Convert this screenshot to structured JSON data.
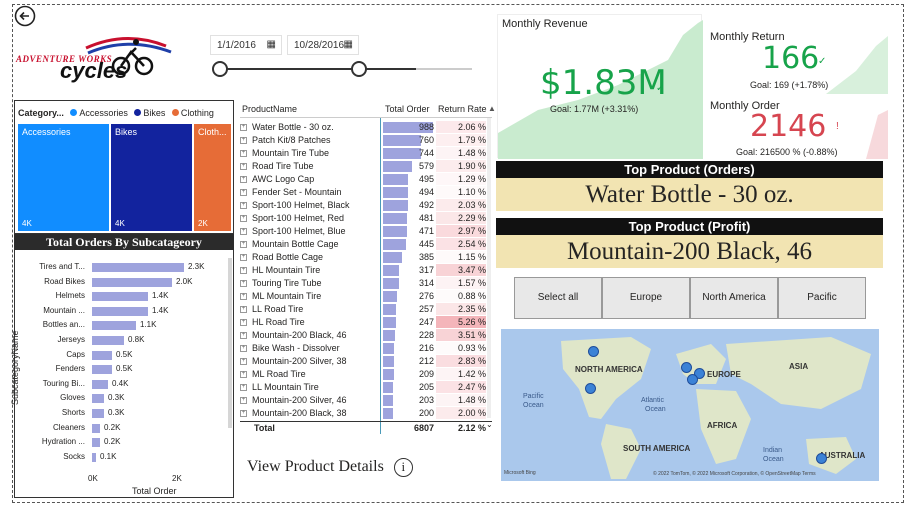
{
  "logo": {
    "line1": "ADVENTURE WORKS",
    "line2": "cycles"
  },
  "dates": {
    "start": "1/1/2016",
    "end": "10/28/2016"
  },
  "treemap": {
    "legend_title": "Category...",
    "tiles": [
      {
        "label": "Accessories",
        "value": "4K",
        "color": "#118dff"
      },
      {
        "label": "Bikes",
        "value": "4K",
        "color": "#12239e"
      },
      {
        "label": "Cloth...",
        "value": "2K",
        "color": "#e66c37"
      }
    ],
    "legend": [
      {
        "label": "Accessories",
        "color": "#118dff"
      },
      {
        "label": "Bikes",
        "color": "#12239e"
      },
      {
        "label": "Clothing",
        "color": "#e66c37"
      }
    ]
  },
  "subcategory_chart": {
    "title": "Total Orders By Subcatageory",
    "ylabel": "SubcategoryName",
    "xlabel": "Total Order",
    "ticks": [
      "0K",
      "2K"
    ]
  },
  "chart_data": {
    "type": "bar",
    "title": "Total Orders By Subcatageory",
    "xlabel": "Total Order",
    "ylabel": "SubcategoryName",
    "categories": [
      "Tires and T...",
      "Road Bikes",
      "Helmets",
      "Mountain ...",
      "Bottles an...",
      "Jerseys",
      "Caps",
      "Fenders",
      "Touring Bi...",
      "Gloves",
      "Shorts",
      "Cleaners",
      "Hydration ...",
      "Socks"
    ],
    "values": [
      2300,
      2000,
      1400,
      1400,
      1100,
      800,
      500,
      500,
      400,
      300,
      300,
      200,
      200,
      100
    ],
    "value_labels": [
      "2.3K",
      "2.0K",
      "1.4K",
      "1.4K",
      "1.1K",
      "0.8K",
      "0.5K",
      "0.5K",
      "0.4K",
      "0.3K",
      "0.3K",
      "0.2K",
      "0.2K",
      "0.1K"
    ],
    "xlim": [
      0,
      2500
    ]
  },
  "table": {
    "headers": {
      "name": "ProductName",
      "order": "Total Order",
      "ret": "Return Rate"
    },
    "rows": [
      {
        "name": "Water Bottle - 30 oz.",
        "order": 988,
        "order_s": "988",
        "ret": 2.06,
        "ret_s": "2.06 %"
      },
      {
        "name": "Patch Kit/8 Patches",
        "order": 760,
        "order_s": "760",
        "ret": 1.79,
        "ret_s": "1.79 %"
      },
      {
        "name": "Mountain Tire Tube",
        "order": 744,
        "order_s": "744",
        "ret": 1.48,
        "ret_s": "1.48 %"
      },
      {
        "name": "Road Tire Tube",
        "order": 579,
        "order_s": "579",
        "ret": 1.9,
        "ret_s": "1.90 %"
      },
      {
        "name": "AWC Logo Cap",
        "order": 495,
        "order_s": "495",
        "ret": 1.29,
        "ret_s": "1.29 %"
      },
      {
        "name": "Fender Set - Mountain",
        "order": 494,
        "order_s": "494",
        "ret": 1.1,
        "ret_s": "1.10 %"
      },
      {
        "name": "Sport-100 Helmet, Black",
        "order": 492,
        "order_s": "492",
        "ret": 2.03,
        "ret_s": "2.03 %"
      },
      {
        "name": "Sport-100 Helmet, Red",
        "order": 481,
        "order_s": "481",
        "ret": 2.29,
        "ret_s": "2.29 %"
      },
      {
        "name": "Sport-100 Helmet, Blue",
        "order": 471,
        "order_s": "471",
        "ret": 2.97,
        "ret_s": "2.97 %"
      },
      {
        "name": "Mountain Bottle Cage",
        "order": 445,
        "order_s": "445",
        "ret": 2.54,
        "ret_s": "2.54 %"
      },
      {
        "name": "Road Bottle Cage",
        "order": 385,
        "order_s": "385",
        "ret": 1.15,
        "ret_s": "1.15 %"
      },
      {
        "name": "HL Mountain Tire",
        "order": 317,
        "order_s": "317",
        "ret": 3.47,
        "ret_s": "3.47 %"
      },
      {
        "name": "Touring Tire Tube",
        "order": 314,
        "order_s": "314",
        "ret": 1.57,
        "ret_s": "1.57 %"
      },
      {
        "name": "ML Mountain Tire",
        "order": 276,
        "order_s": "276",
        "ret": 0.88,
        "ret_s": "0.88 %"
      },
      {
        "name": "LL Road Tire",
        "order": 257,
        "order_s": "257",
        "ret": 2.35,
        "ret_s": "2.35 %"
      },
      {
        "name": "HL Road Tire",
        "order": 247,
        "order_s": "247",
        "ret": 5.26,
        "ret_s": "5.26 %"
      },
      {
        "name": "Mountain-200 Black, 46",
        "order": 228,
        "order_s": "228",
        "ret": 3.51,
        "ret_s": "3.51 %"
      },
      {
        "name": "Bike Wash - Dissolver",
        "order": 216,
        "order_s": "216",
        "ret": 0.93,
        "ret_s": "0.93 %"
      },
      {
        "name": "Mountain-200 Silver, 38",
        "order": 212,
        "order_s": "212",
        "ret": 2.83,
        "ret_s": "2.83 %"
      },
      {
        "name": "ML Road Tire",
        "order": 209,
        "order_s": "209",
        "ret": 1.42,
        "ret_s": "1.42 %"
      },
      {
        "name": "LL Mountain Tire",
        "order": 205,
        "order_s": "205",
        "ret": 2.47,
        "ret_s": "2.47 %"
      },
      {
        "name": "Mountain-200 Silver, 46",
        "order": 203,
        "order_s": "203",
        "ret": 1.48,
        "ret_s": "1.48 %"
      },
      {
        "name": "Mountain-200 Black, 38",
        "order": 200,
        "order_s": "200",
        "ret": 2.0,
        "ret_s": "2.00 %"
      }
    ],
    "total": {
      "label": "Total",
      "order": "6807",
      "ret": "2.12 %"
    }
  },
  "kpi": {
    "revenue": {
      "title": "Monthly Revenue",
      "value": "$1.83M",
      "goal": "Goal: 1.77M (+3.31%)",
      "color": "#17a34a"
    },
    "ret": {
      "title": "Monthly Return",
      "value": "166",
      "goal": "Goal: 169 (+1.78%)",
      "color": "#17a34a"
    },
    "order": {
      "title": "Monthly Order",
      "value": "2146",
      "goal": "Goal: 216500 % (-0.88%)",
      "color": "#d64550"
    }
  },
  "top_orders": {
    "title": "Top Product (Orders)",
    "value": "Water Bottle - 30 oz."
  },
  "top_profit": {
    "title": "Top Product (Profit)",
    "value": "Mountain-200 Black, 46"
  },
  "regions": [
    "Select all",
    "Europe",
    "North America",
    "Pacific"
  ],
  "map": {
    "labels": {
      "na": "NORTH AMERICA",
      "eu": "EUROPE",
      "asia": "ASIA",
      "africa": "AFRICA",
      "sa": "SOUTH AMERICA",
      "au": "AUSTRALIA"
    },
    "oceans": {
      "pac1": "Pacific",
      "pac2": "Ocean",
      "atl1": "Atlantic",
      "atl2": "Ocean",
      "ind1": "Indian",
      "ind2": "Ocean"
    },
    "attribution": "© 2022 TomTom, © 2022 Microsoft Corporation, © OpenStreetMap  Terms",
    "brand": "Microsoft Bing"
  },
  "view_details": "View Product Details"
}
